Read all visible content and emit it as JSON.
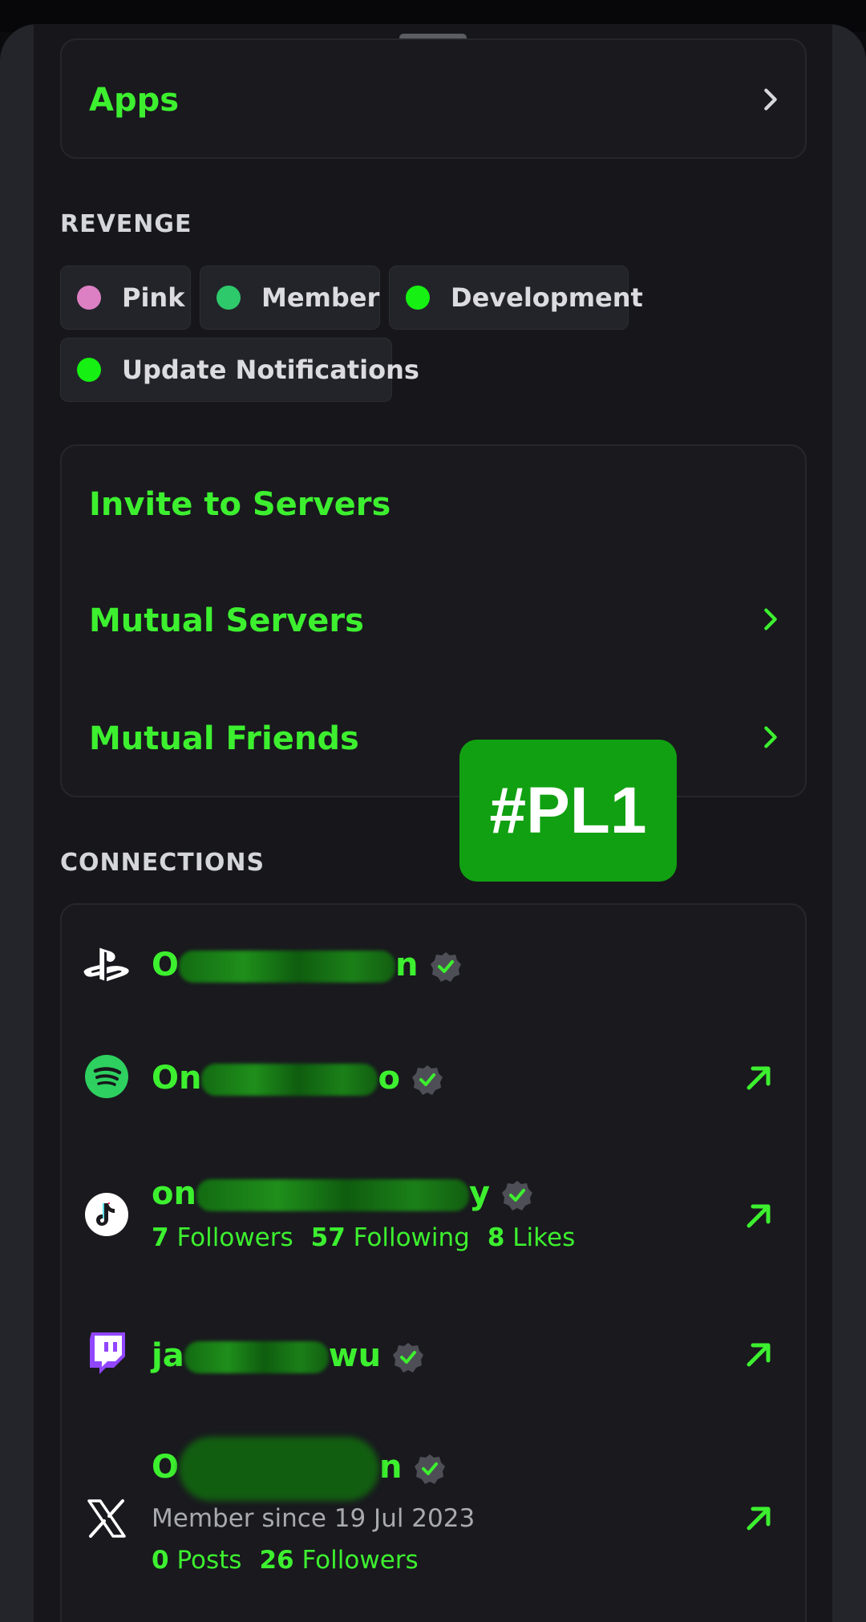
{
  "apps": {
    "title": "Apps"
  },
  "roles": {
    "heading": "REVENGE",
    "items": [
      {
        "label": "Pink",
        "color": "#dc7fc3"
      },
      {
        "label": "Member",
        "color": "#2ec96b"
      },
      {
        "label": "Development",
        "color": "#16f012"
      },
      {
        "label": "Update Notifications",
        "color": "#16f012"
      }
    ]
  },
  "actions": {
    "invite": "Invite to Servers",
    "mutual_servers": "Mutual Servers",
    "mutual_friends": "Mutual Friends"
  },
  "overlay_tag": "#PL1",
  "connections": {
    "heading": "CONNECTIONS",
    "items": [
      {
        "service": "playstation-icon",
        "name_start": "O",
        "name_end": "n"
      },
      {
        "service": "spotify-icon",
        "name_start": "On",
        "name_end": "o"
      },
      {
        "service": "tiktok-icon",
        "name_start": "on",
        "name_end": "y",
        "stats": {
          "followers_count": "7",
          "followers_label": "Followers",
          "following_count": "57",
          "following_label": "Following",
          "likes_count": "8",
          "likes_label": "Likes"
        }
      },
      {
        "service": "twitch-icon",
        "name_start": "ja",
        "name_end": "wu"
      },
      {
        "service": "x-icon",
        "name_start": "O",
        "name_end": "n",
        "member_since": "Member since 19 Jul 2023",
        "stats": {
          "posts_count": "0",
          "posts_label": "Posts",
          "followers_count": "26",
          "followers_label": "Followers"
        }
      }
    ]
  },
  "colors": {
    "accent": "#3df02f",
    "background": "#17171b",
    "card": "#19191e"
  }
}
